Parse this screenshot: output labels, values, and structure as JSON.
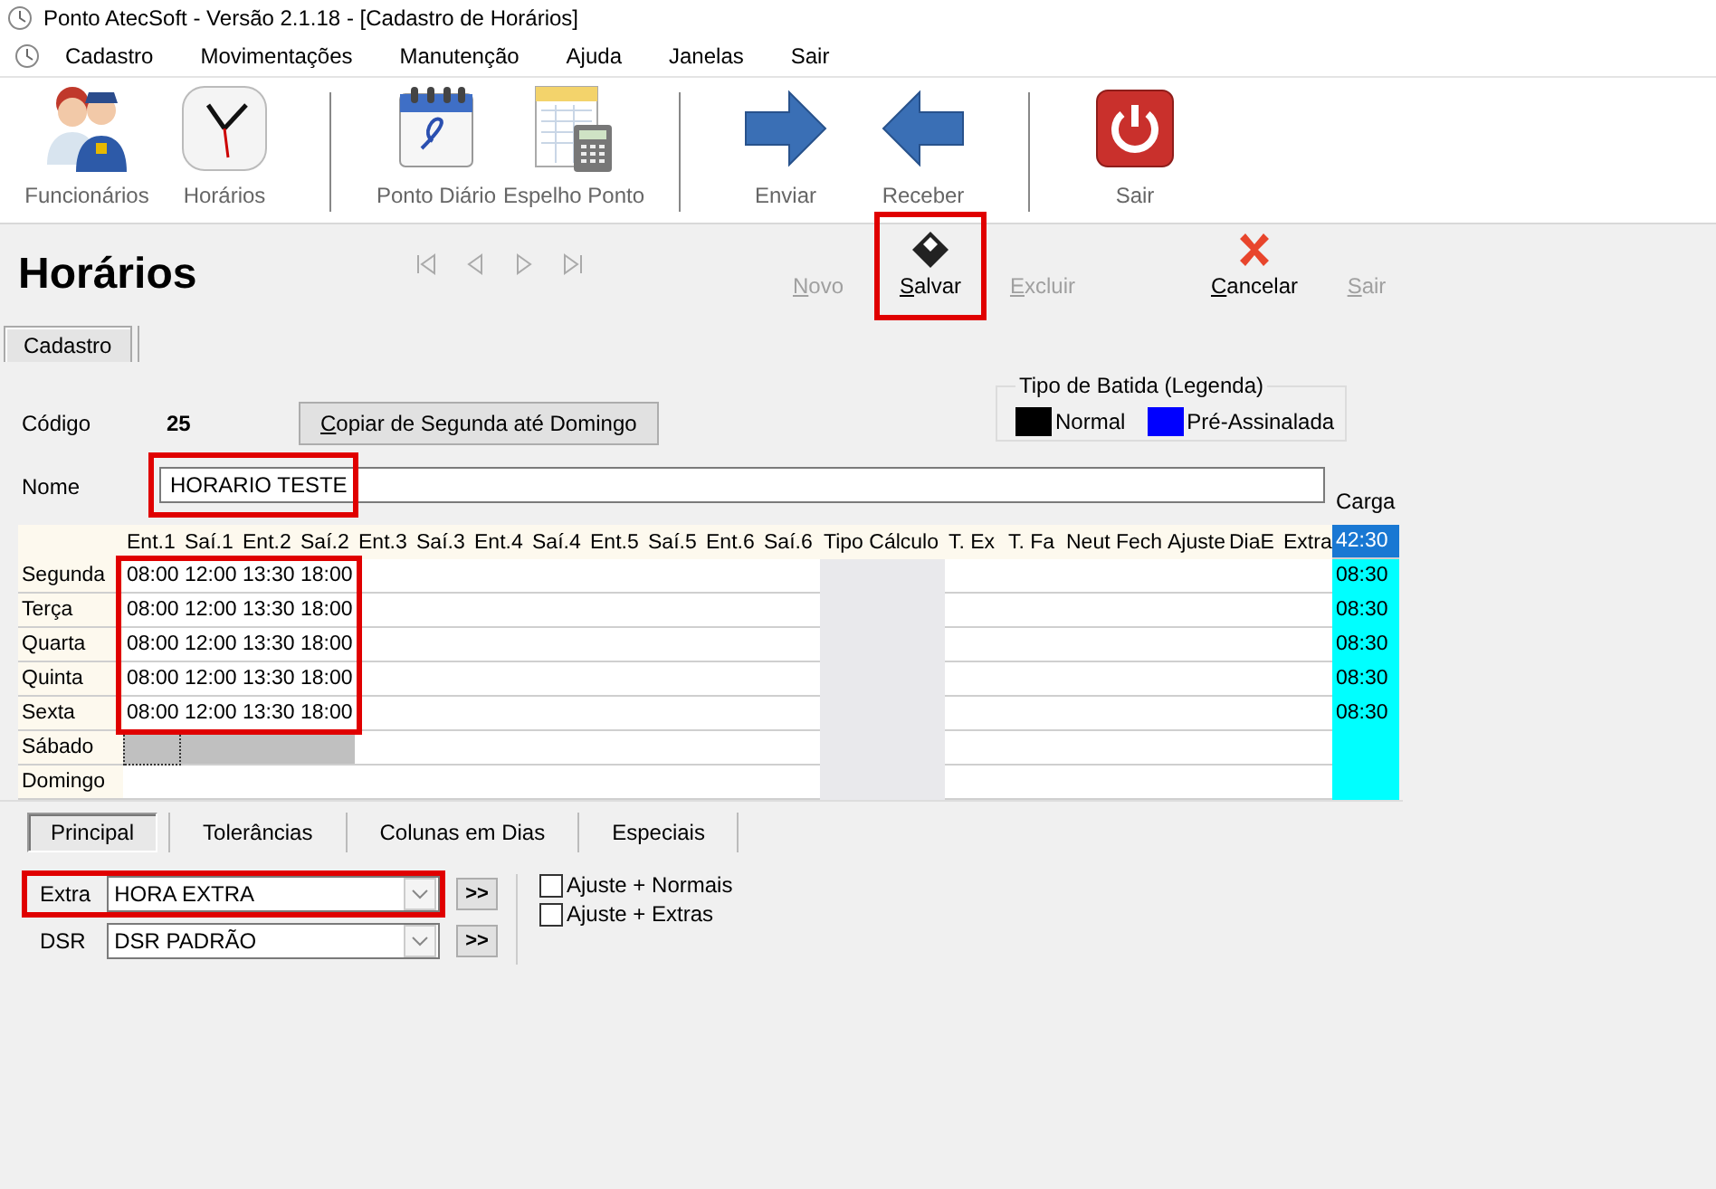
{
  "window": {
    "title": "Ponto AtecSoft - Versão 2.1.18 - [Cadastro de Horários]"
  },
  "menu": [
    "Cadastro",
    "Movimentações",
    "Manutenção",
    "Ajuda",
    "Janelas",
    "Sair"
  ],
  "toolbar_groups": [
    [
      {
        "label": "Funcionários",
        "kind": "people"
      },
      {
        "label": "Horários",
        "kind": "clock"
      }
    ],
    [
      {
        "label": "Ponto Diário",
        "kind": "calendar"
      },
      {
        "label": "Espelho Ponto",
        "kind": "sheet"
      }
    ],
    [
      {
        "label": "Enviar",
        "kind": "right"
      },
      {
        "label": "Receber",
        "kind": "left"
      }
    ],
    [
      {
        "label": "Sair",
        "kind": "power"
      }
    ]
  ],
  "page": {
    "title": "Horários",
    "nav_buttons": [
      {
        "kind": "first",
        "disabled": true
      },
      {
        "kind": "prev",
        "disabled": true
      },
      {
        "kind": "next",
        "disabled": true
      },
      {
        "kind": "last",
        "disabled": true
      }
    ],
    "actions": [
      {
        "label": "Novo",
        "kind": "none",
        "disabled": true,
        "highlighted": false
      },
      {
        "label": "Salvar",
        "kind": "save",
        "disabled": false,
        "highlighted": true
      },
      {
        "label": "Excluir",
        "kind": "none",
        "disabled": true,
        "highlighted": false
      },
      {
        "label": "Cancelar",
        "kind": "cancel",
        "disabled": false,
        "highlighted": false
      },
      {
        "label": "Sair",
        "kind": "none",
        "disabled": true,
        "highlighted": false
      }
    ]
  },
  "tabs": [
    {
      "label": "Cadastro",
      "selected": true
    }
  ],
  "form": {
    "codigo_label": "Código",
    "codigo": "25",
    "copy_button": "Copiar de Segunda até Domingo",
    "legend": {
      "title": "Tipo de Batida (Legenda)",
      "items": [
        {
          "label": "Normal",
          "color": "#000000"
        },
        {
          "label": "Pré-Assinalada",
          "color": "#0000ff"
        }
      ]
    },
    "nome_label": "Nome",
    "nome": {
      "value": "HORARIO TESTE",
      "highlighted": true
    },
    "carga_label": "Carga"
  },
  "grid": {
    "columns": [
      "Ent.1",
      "Saí.1",
      "Ent.2",
      "Saí.2",
      "Ent.3",
      "Saí.3",
      "Ent.4",
      "Saí.4",
      "Ent.5",
      "Saí.5",
      "Ent.6",
      "Saí.6",
      "Tipo Cálculo",
      "T. Ex",
      "T. Fa",
      "Neut Fech",
      "Ajuste",
      "DiaE",
      "Extra"
    ],
    "total": "42:30",
    "times_highlighted": true,
    "rows": [
      {
        "day": "Segunda",
        "times": [
          "08:00",
          "12:00",
          "13:30",
          "18:00"
        ],
        "carga": "08:30",
        "selected": false
      },
      {
        "day": "Terça",
        "times": [
          "08:00",
          "12:00",
          "13:30",
          "18:00"
        ],
        "carga": "08:30",
        "selected": false
      },
      {
        "day": "Quarta",
        "times": [
          "08:00",
          "12:00",
          "13:30",
          "18:00"
        ],
        "carga": "08:30",
        "selected": false
      },
      {
        "day": "Quinta",
        "times": [
          "08:00",
          "12:00",
          "13:30",
          "18:00"
        ],
        "carga": "08:30",
        "selected": false
      },
      {
        "day": "Sexta",
        "times": [
          "08:00",
          "12:00",
          "13:30",
          "18:00"
        ],
        "carga": "08:30",
        "selected": false
      },
      {
        "day": "Sábado",
        "times": [],
        "selected": true
      },
      {
        "day": "Domingo",
        "times": [],
        "selected": false
      }
    ]
  },
  "options": {
    "tabs": [
      {
        "label": "Principal",
        "selected": true
      },
      {
        "label": "Tolerâncias",
        "selected": false
      },
      {
        "label": "Colunas em Dias",
        "selected": false
      },
      {
        "label": "Especiais",
        "selected": false
      }
    ],
    "combos": [
      {
        "label": "Extra",
        "value": "HORA EXTRA",
        "button": ">>",
        "highlighted": true
      },
      {
        "label": "DSR",
        "value": "DSR PADRÃO",
        "button": ">>",
        "highlighted": false
      }
    ],
    "checkboxes": [
      {
        "label": "Ajuste + Normais",
        "checked": false
      },
      {
        "label": "Ajuste + Extras",
        "checked": false
      }
    ]
  }
}
